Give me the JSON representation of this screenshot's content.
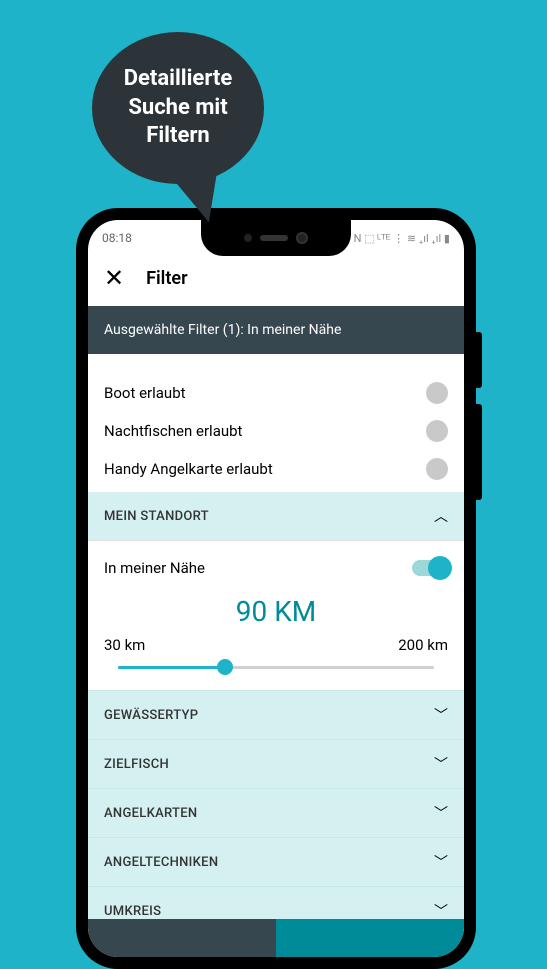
{
  "promo": {
    "text": "Detaillierte Suche mit Filtern"
  },
  "statusBar": {
    "time": "08:18",
    "icons": "N ⬚ ᴸᵀᴱ ⋮ ≋ ₊ıl ₊ıl ▮"
  },
  "header": {
    "title": "Filter"
  },
  "selectedFilters": {
    "text": "Ausgewählte Filter (1): In meiner Nähe"
  },
  "filterOptions": [
    {
      "label": "Boot erlaubt"
    },
    {
      "label": "Nachtfischen erlaubt"
    },
    {
      "label": "Handy Angelkarte erlaubt"
    }
  ],
  "locationSection": {
    "title": "MEIN STANDORT",
    "toggleLabel": "In meiner Nähe",
    "distanceValue": "90 KM",
    "minLabel": "30 km",
    "maxLabel": "200 km"
  },
  "collapsedSections": [
    {
      "title": "GEWÄSSERTYP"
    },
    {
      "title": "ZIELFISCH"
    },
    {
      "title": "ANGELKARTEN"
    },
    {
      "title": "ANGELTECHNIKEN"
    },
    {
      "title": "UMKREIS"
    }
  ]
}
